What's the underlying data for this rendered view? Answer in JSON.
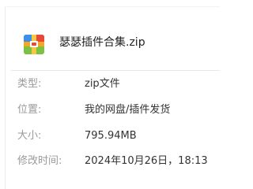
{
  "file": {
    "name": "瑟瑟插件合集.zip",
    "icon": "zip-archive-icon"
  },
  "details": [
    {
      "label": "类型:",
      "value": "zip文件"
    },
    {
      "label": "位置:",
      "value": "我的网盘/插件发货"
    },
    {
      "label": "大小:",
      "value": "795.94MB"
    },
    {
      "label": "修改时间:",
      "value": "2024年10月26日，18:13"
    }
  ],
  "colors": {
    "label": "#9a9a9a",
    "value": "#333333",
    "title": "#222222",
    "icon_green": "#7bc144",
    "icon_orange": "#f5a623",
    "icon_red": "#e8483a",
    "icon_blue": "#3d8fe8"
  }
}
